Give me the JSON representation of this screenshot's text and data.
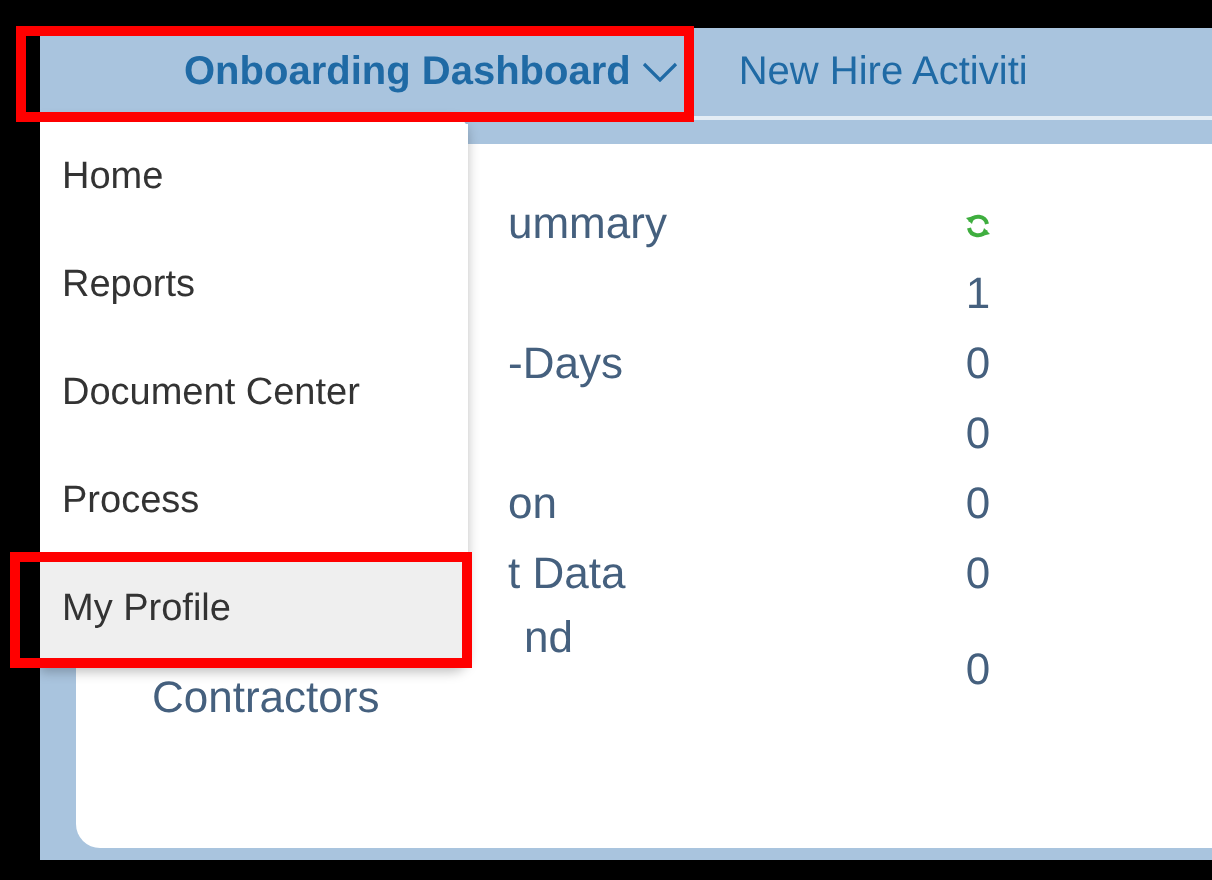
{
  "tabs": [
    {
      "label": "Onboarding Dashboard",
      "selected": true,
      "highlighted": true
    },
    {
      "label": "New Hire Activiti",
      "selected": false,
      "highlighted": false
    }
  ],
  "card": {
    "rows": [
      {
        "lines": [
          {
            "text": "ummary",
            "kind": "cut"
          }
        ],
        "kind": "refresh"
      },
      {
        "lines": [],
        "value": "1"
      },
      {
        "lines": [
          {
            "text": "-Days",
            "kind": "cut"
          }
        ],
        "value": "0"
      },
      {
        "lines": [],
        "value": "0"
      },
      {
        "lines": [
          {
            "text": "on",
            "kind": "cut"
          }
        ],
        "value": "0"
      },
      {
        "lines": [
          {
            "text": "t Data",
            "kind": "cut"
          }
        ],
        "value": "0"
      },
      {
        "lines": [
          {
            "text": "nd",
            "kind": "cutmore"
          },
          {
            "text": "Contractors",
            "kind": "full"
          }
        ],
        "value": "0"
      }
    ]
  },
  "menu": {
    "items": [
      {
        "label": "Home",
        "selected": false,
        "highlighted": false
      },
      {
        "label": "Reports",
        "selected": false,
        "highlighted": false
      },
      {
        "label": "Document Center",
        "selected": false,
        "highlighted": false
      },
      {
        "label": "Process",
        "selected": false,
        "highlighted": false
      },
      {
        "label": "My Profile",
        "selected": true,
        "highlighted": true
      }
    ]
  }
}
